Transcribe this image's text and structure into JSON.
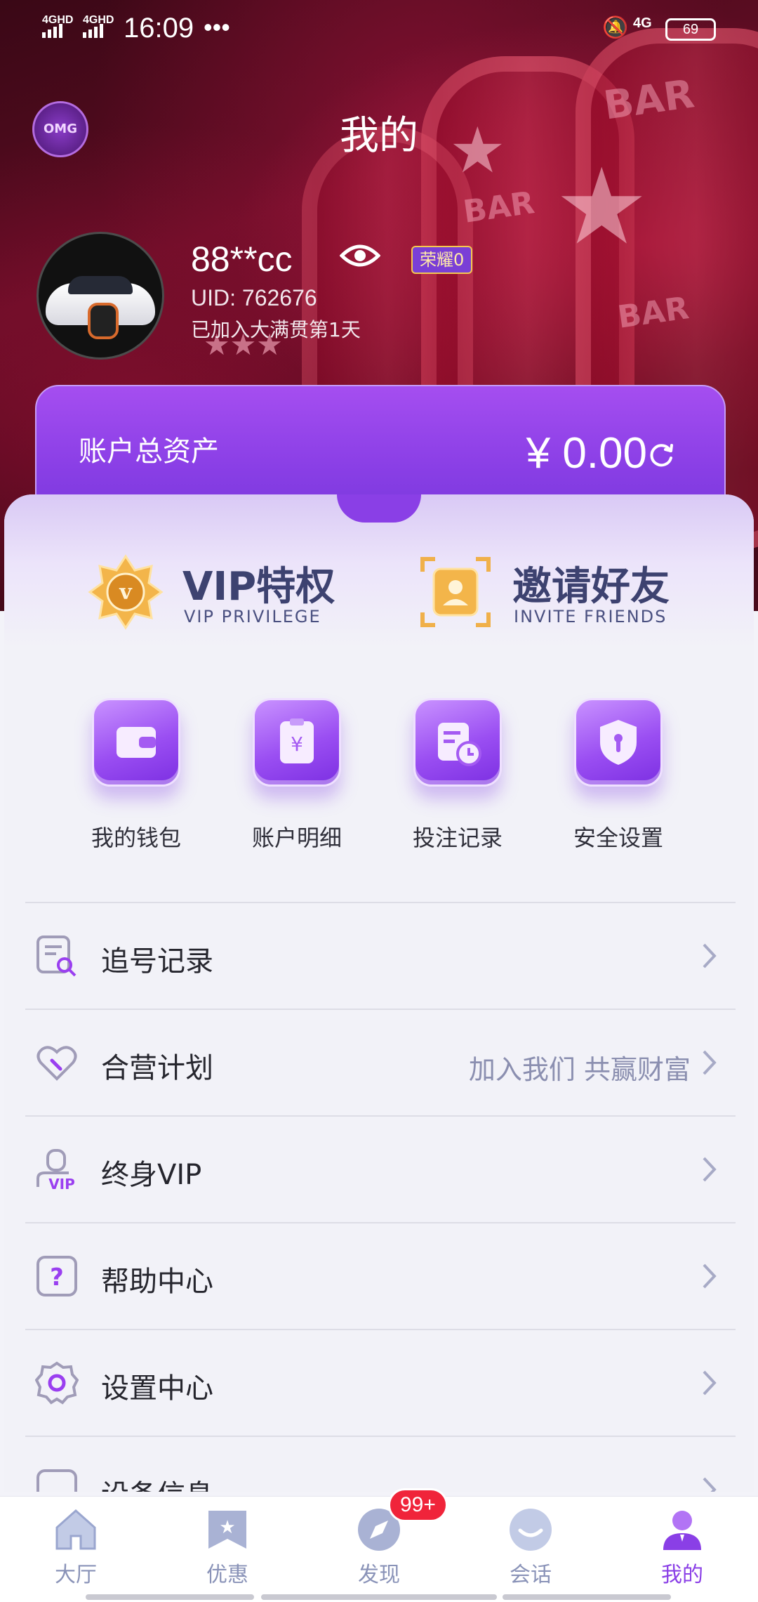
{
  "status_bar": {
    "network_1": "4GHD",
    "network_2": "4GHD",
    "time": "16:09",
    "more": "•••",
    "data_type": "4G",
    "battery": "69"
  },
  "header": {
    "logo_text": "OMG",
    "title": "我的"
  },
  "profile": {
    "username": "88**cc",
    "honor_badge": "荣耀0",
    "uid": "UID: 762676",
    "joined": "已加入大满贯第1天"
  },
  "assets": {
    "label": "账户总资产",
    "value": "¥ 0.00"
  },
  "promos": [
    {
      "title": "VIP特权",
      "subtitle": "VIP PRIVILEGE",
      "icon": "vip-badge-icon"
    },
    {
      "title": "邀请好友",
      "subtitle": "INVITE FRIENDS",
      "icon": "invite-friend-icon"
    }
  ],
  "quick_actions": [
    {
      "label": "我的钱包",
      "icon": "wallet-icon"
    },
    {
      "label": "账户明细",
      "icon": "bill-icon"
    },
    {
      "label": "投注记录",
      "icon": "bet-record-icon"
    },
    {
      "label": "安全设置",
      "icon": "shield-icon"
    }
  ],
  "menu": [
    {
      "label": "追号记录",
      "extra": "",
      "icon": "search-record-icon"
    },
    {
      "label": "合营计划",
      "extra": "加入我们 共赢财富",
      "icon": "handshake-icon"
    },
    {
      "label": "终身VIP",
      "extra": "",
      "icon": "vip-user-icon"
    },
    {
      "label": "帮助中心",
      "extra": "",
      "icon": "help-icon"
    },
    {
      "label": "设置中心",
      "extra": "",
      "icon": "gear-icon"
    },
    {
      "label": "设备信息",
      "extra": "",
      "icon": "device-icon"
    }
  ],
  "tabbar": [
    {
      "label": "大厅",
      "icon": "home-icon",
      "active": false
    },
    {
      "label": "优惠",
      "icon": "coupon-icon",
      "active": false
    },
    {
      "label": "发现",
      "icon": "discover-icon",
      "active": false,
      "badge": "99+"
    },
    {
      "label": "会话",
      "icon": "chat-icon",
      "active": false
    },
    {
      "label": "我的",
      "icon": "profile-icon",
      "active": true
    }
  ],
  "colors": {
    "accent": "#8a3fe6",
    "badge": "#f0243a",
    "tab_inactive": "#8a93b8"
  }
}
